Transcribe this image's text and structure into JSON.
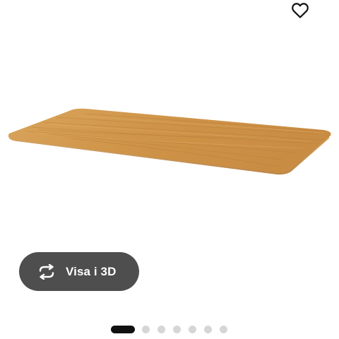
{
  "favorite": {
    "icon": "heart-outline-icon"
  },
  "product": {
    "image": "bamboo-tabletop-image"
  },
  "view3d": {
    "label": "Visa i 3D",
    "icon": "rotate-arrows-icon"
  },
  "carousel": {
    "total": 7,
    "active_index": 0
  },
  "colors": {
    "button_bg": "#4e4e4e",
    "dot_active": "#111111",
    "dot_inactive": "#d6d6d6"
  }
}
